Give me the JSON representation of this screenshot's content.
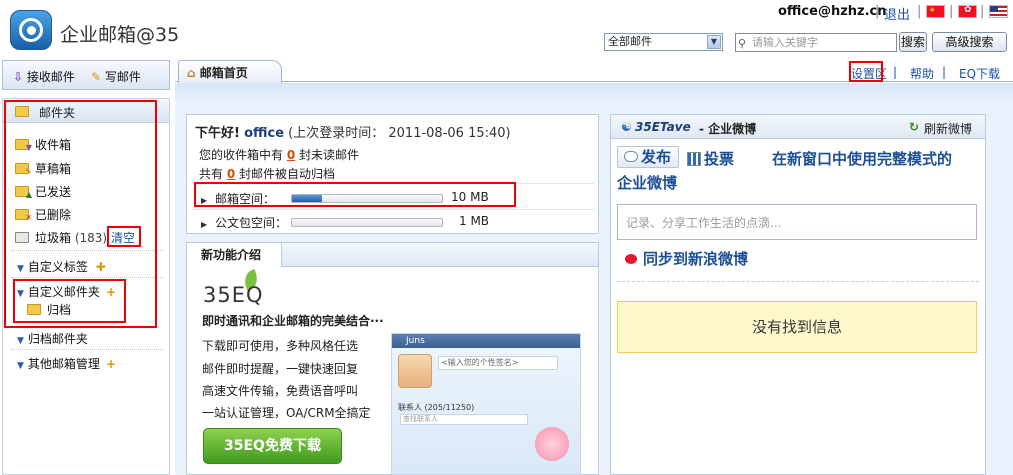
{
  "header": {
    "app_title": "企业邮箱@35",
    "user_email": "office@hzhz.cn",
    "separator": "|",
    "logout": "退出",
    "folder_select": "全部邮件",
    "search_placeholder": "请输入关键字",
    "search_button": "搜索",
    "advanced_search_button": "高级搜索"
  },
  "sidebar": {
    "receive_button": "接收邮件",
    "compose_button": "写邮件",
    "mail_folders_title": "邮件夹",
    "folders": [
      {
        "label": "收件箱"
      },
      {
        "label": "草稿箱"
      },
      {
        "label": "已发送"
      },
      {
        "label": "已删除"
      }
    ],
    "trash": {
      "label": "垃圾箱",
      "count": "(183)",
      "clear": "清空"
    },
    "custom_tags": "自定义标签",
    "custom_folders": "自定义邮件夹",
    "archive": "归档",
    "archive_folders": "归档邮件夹",
    "other_mailbox": "其他邮箱管理",
    "plus": "+"
  },
  "tabs": {
    "home": "邮箱首页",
    "settings": "设置区",
    "help": "帮助",
    "eq_download": "EQ下载",
    "separator": "|"
  },
  "welcome": {
    "greeting": "下午好!",
    "username": "office",
    "last_login_label": "(上次登录时间：",
    "last_login_time": "2011-08-06 15:40)",
    "unread_prefix": "您的收件箱中有",
    "unread_count": "0",
    "unread_suffix": "封未读邮件",
    "archived_prefix": "共有",
    "archived_count": "0",
    "archived_suffix": "封邮件被自动归档",
    "mailbox_space_label": "邮箱空间：",
    "mailbox_space_value": "10 MB",
    "mailbox_space_fill": 0.2,
    "briefcase_label": "公文包空间：",
    "briefcase_value": "1 MB",
    "briefcase_fill": 0.0
  },
  "features": {
    "tab_title": "新功能介绍",
    "product": "35EQ",
    "tagline": "即时通讯和企业邮箱的完美结合···",
    "lines": [
      "下载即可使用，多种风格任选",
      "邮件即时提醒，一键快速回复",
      "高速文件传输，免费语音呼叫",
      "一站认证管理，OA/CRM全搞定"
    ],
    "download_button": "35EQ免费下载",
    "shot_user": "Juns",
    "shot_signature": "<输入您的个性签名>",
    "shot_contacts": "联系人 (205/11250)",
    "shot_find": "查找联系人"
  },
  "weibo": {
    "title_brand": "35ETave",
    "title_text": "- 企业微博",
    "refresh": "刷新微博",
    "post": "发布",
    "vote": "投票",
    "full_mode": "在新窗口中使用完整模式的",
    "full_mode_2": "企业微博",
    "input_placeholder": "记录、分享工作生活的点滴...",
    "sync": "同步到新浪微博",
    "empty": "没有找到信息"
  },
  "colors": {
    "link_blue": "#1b54a8",
    "unread_orange": "#e04b00",
    "highlight_red": "#e00000"
  }
}
